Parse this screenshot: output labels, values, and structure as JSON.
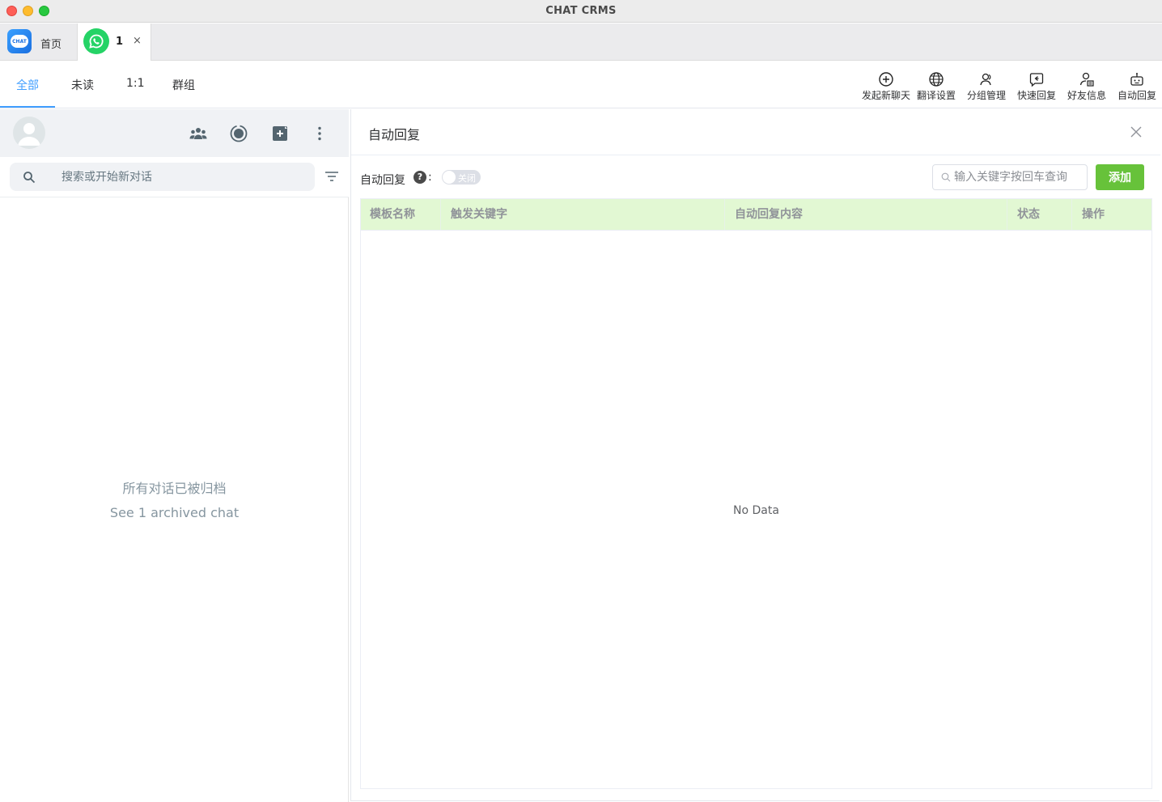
{
  "window": {
    "title": "CHAT CRMS"
  },
  "app_tabs": {
    "home": {
      "label": "首页",
      "logo_text": "CHAT"
    },
    "whatsapp": {
      "label": "1",
      "close": "×"
    }
  },
  "filter_tabs": [
    {
      "label": "全部",
      "active": true
    },
    {
      "label": "未读",
      "active": false
    },
    {
      "label": "1:1",
      "active": false
    },
    {
      "label": "群组",
      "active": false
    }
  ],
  "toolbar": [
    {
      "label": "发起新聊天",
      "icon": "plus-circle-icon"
    },
    {
      "label": "翻译设置",
      "icon": "globe-icon"
    },
    {
      "label": "分组管理",
      "icon": "users-icon"
    },
    {
      "label": "快速回复",
      "icon": "reply-icon"
    },
    {
      "label": "好友信息",
      "icon": "contact-icon"
    },
    {
      "label": "自动回复",
      "icon": "robot-icon"
    }
  ],
  "left_panel": {
    "header_icons": [
      "communities-icon",
      "status-icon",
      "new-chat-icon",
      "menu-icon"
    ],
    "search": {
      "placeholder": "搜索或开始新对话"
    },
    "empty_title": "所有对话已被归档",
    "archived_link": "See 1 archived chat"
  },
  "dialog": {
    "title": "自动回复",
    "auto_reply_label": "自动回复",
    "help": "?",
    "colon": ":",
    "switch_text": "关闭",
    "switch_on": false,
    "search_placeholder": "输入关键字按回车查询",
    "add_button": "添加",
    "columns": [
      "模板名称",
      "触发关键字",
      "自动回复内容",
      "状态",
      "操作"
    ],
    "rows": [],
    "empty_text": "No Data"
  },
  "colors": {
    "accent": "#409eff",
    "header_bg": "#e2f8d3",
    "add_button": "#67c23a",
    "whatsapp": "#25d366"
  }
}
